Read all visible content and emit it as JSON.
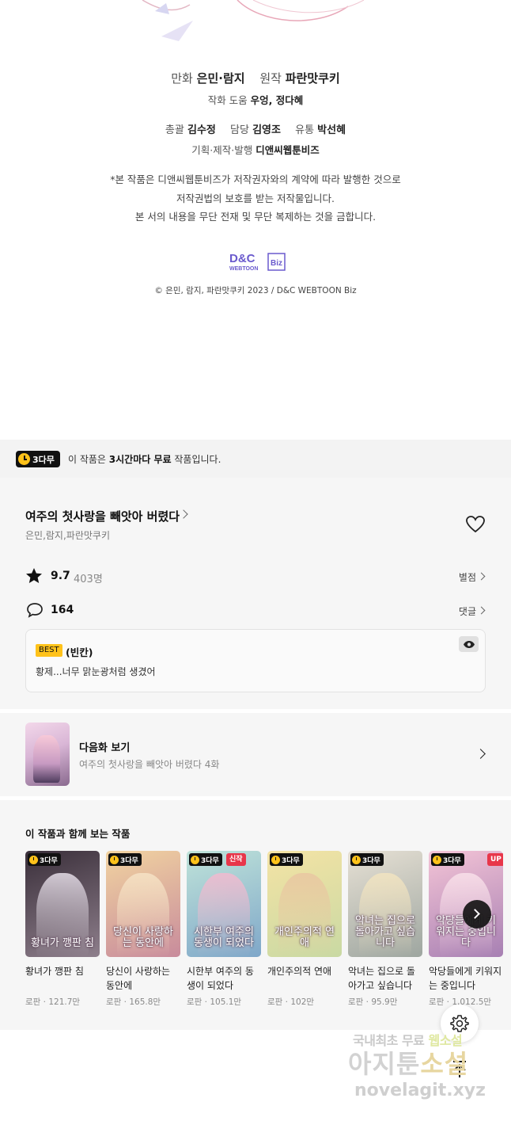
{
  "credits": {
    "line1_role_a": "만화",
    "line1_name_a": "은민·람지",
    "line1_role_b": "원작",
    "line1_name_b": "파란맛쿠키",
    "line2_role": "작화 도움",
    "line2_names": "우엉, 정다혜",
    "line3_role_a": "총괄",
    "line3_name_a": "김수정",
    "line3_role_b": "담당",
    "line3_name_b": "김영조",
    "line3_role_c": "유통",
    "line3_name_c": "박선혜",
    "line4_role": "기획·제작·발행",
    "line4_name": "디앤씨웹툰비즈",
    "notice_1": "*본 작품은 디앤씨웹툰비즈가 저작권자와의 계약에 따라 발행한 것으로",
    "notice_2": "저작권법의 보호를 받는 저작물입니다.",
    "notice_3": "본 서의 내용을 무단 전재 및 무단 복제하는 것을 금합니다.",
    "logo_top": "D&C",
    "logo_bottom": "WEBTOON",
    "logo_side": "Biz",
    "copyright": "© 은민, 람지, 파란맛쿠키 2023 / D&C WEBTOON Biz"
  },
  "banner": {
    "badge": "3다무",
    "text_pre": "이 작품은 ",
    "text_bold": "3시간마다 무료",
    "text_post": " 작품입니다."
  },
  "work": {
    "title": "여주의 첫사랑을 빼앗아 버렸다",
    "authors": "은민,람지,파란맛쿠키",
    "rating": "9.7",
    "rating_count": "403명",
    "rating_link": "별점",
    "comment_count": "164",
    "comment_link": "댓글"
  },
  "best_comment": {
    "badge": "BEST",
    "author": "(빈칸)",
    "text": "황제...너무 맑눈광처럼 생겼어"
  },
  "next_episode": {
    "label": "다음화 보기",
    "subtitle": "여주의 첫사랑을 빼앗아 버렸다 4화"
  },
  "recommendations": {
    "heading": "이 작품과 함께 보는 작품",
    "items": [
      {
        "badge": "3다무",
        "tag": "",
        "cover_text": "황녀가 깽판 침",
        "title": "황녀가 깽판 침",
        "meta": "로판 · 121.7만",
        "c1": "#3a2f3a",
        "c2": "#8e7f8c",
        "art": "#e8e0ea"
      },
      {
        "badge": "3다무",
        "tag": "",
        "cover_text": "당신이 사랑하는 동안에",
        "title": "당신이 사랑하는 동안에",
        "meta": "로판 · 165.8만",
        "c1": "#f1d3a0",
        "c2": "#c88b9c",
        "art": "#f6e3c6"
      },
      {
        "badge": "3다무",
        "tag": "신작",
        "cover_text": "시한부 여주의 동생이 되었다",
        "title": "시한부 여주의 동생이 되었다",
        "meta": "로판 · 105.1만",
        "c1": "#bfe3d9",
        "c2": "#7fa7c9",
        "art": "#f3b9cf"
      },
      {
        "badge": "3다무",
        "tag": "",
        "cover_text": "개인주의적 연애",
        "title": "개인주의적 연애",
        "meta": "로판 · 102만",
        "c1": "#f4e3a5",
        "c2": "#c9d9a3",
        "art": "#e9c6a1"
      },
      {
        "badge": "3다무",
        "tag": "",
        "cover_text": "악녀는 집으로 돌아가고 싶습니다",
        "title": "악녀는 집으로 돌아가고 싶습니다",
        "meta": "로판 · 95.9만",
        "c1": "#e6e0d4",
        "c2": "#9ea6a0",
        "art": "#f2e4c0"
      },
      {
        "badge": "3다무",
        "tag": "UP",
        "cover_text": "악당들에게 키워지는 중입니다",
        "title": "악당들에게 키워지는 중입니다",
        "meta": "로판 · 1,012.5만",
        "c1": "#f4c4d6",
        "c2": "#a780b3",
        "art": "#f9e1ea"
      }
    ]
  },
  "watermark": {
    "line1_a": "국내최초 무료",
    "line1_b": "웹소설",
    "line2_a": "아지툰",
    "line2_b": "소설",
    "line3": "novelagit.xyz"
  },
  "colors": {
    "accent_yellow": "#ffc21a",
    "tag_new": "#e8364a",
    "tag_up": "#e8364a",
    "logo_purple": "#6a5acd"
  },
  "icons": {
    "heart": "heart-icon",
    "star": "star-icon",
    "comment": "speech-bubble-icon",
    "eye": "eye-icon",
    "gear": "gear-icon",
    "top": "arrow-up-to-top-icon",
    "clock": "clock-icon"
  }
}
